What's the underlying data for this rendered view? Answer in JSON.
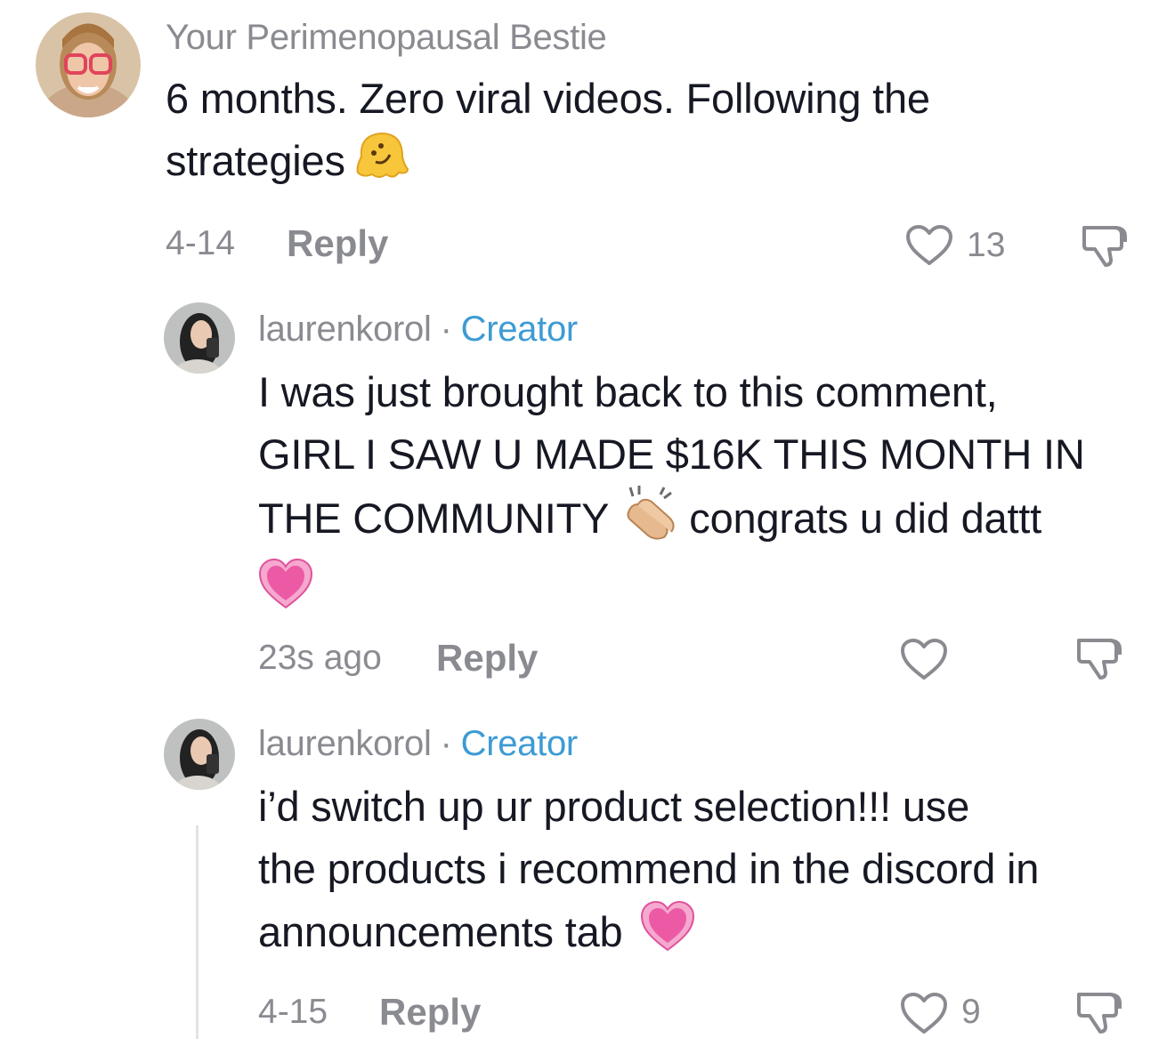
{
  "comments": [
    {
      "username": "Your Perimenopausal Bestie",
      "creator_badge": "",
      "lines": [
        "6 months. Zero viral videos. Following the",
        "strategies"
      ],
      "emoji": "melting-face",
      "date": "4-14",
      "reply_label": "Reply",
      "likes": "13"
    },
    {
      "username": "laurenkorol",
      "separator": "·",
      "creator_badge": "Creator",
      "lines": [
        "I was just brought back to this comment,",
        "GIRL I SAW U MADE $16K THIS MONTH IN",
        "THE COMMUNITY",
        "congrats u did dattt"
      ],
      "emoji": "clapping-hands",
      "emoji2": "growing-heart",
      "date": "23s ago",
      "reply_label": "Reply",
      "likes": ""
    },
    {
      "username": "laurenkorol",
      "separator": "·",
      "creator_badge": "Creator",
      "lines": [
        "i’d switch up ur product selection!!! use",
        "the products i recommend in the discord in",
        "announcements tab"
      ],
      "emoji": "growing-heart",
      "date": "4-15",
      "reply_label": "Reply",
      "likes": "9"
    }
  ],
  "colors": {
    "muted": "#8a8b91",
    "creator": "#3d9bd4",
    "text": "#161823"
  }
}
